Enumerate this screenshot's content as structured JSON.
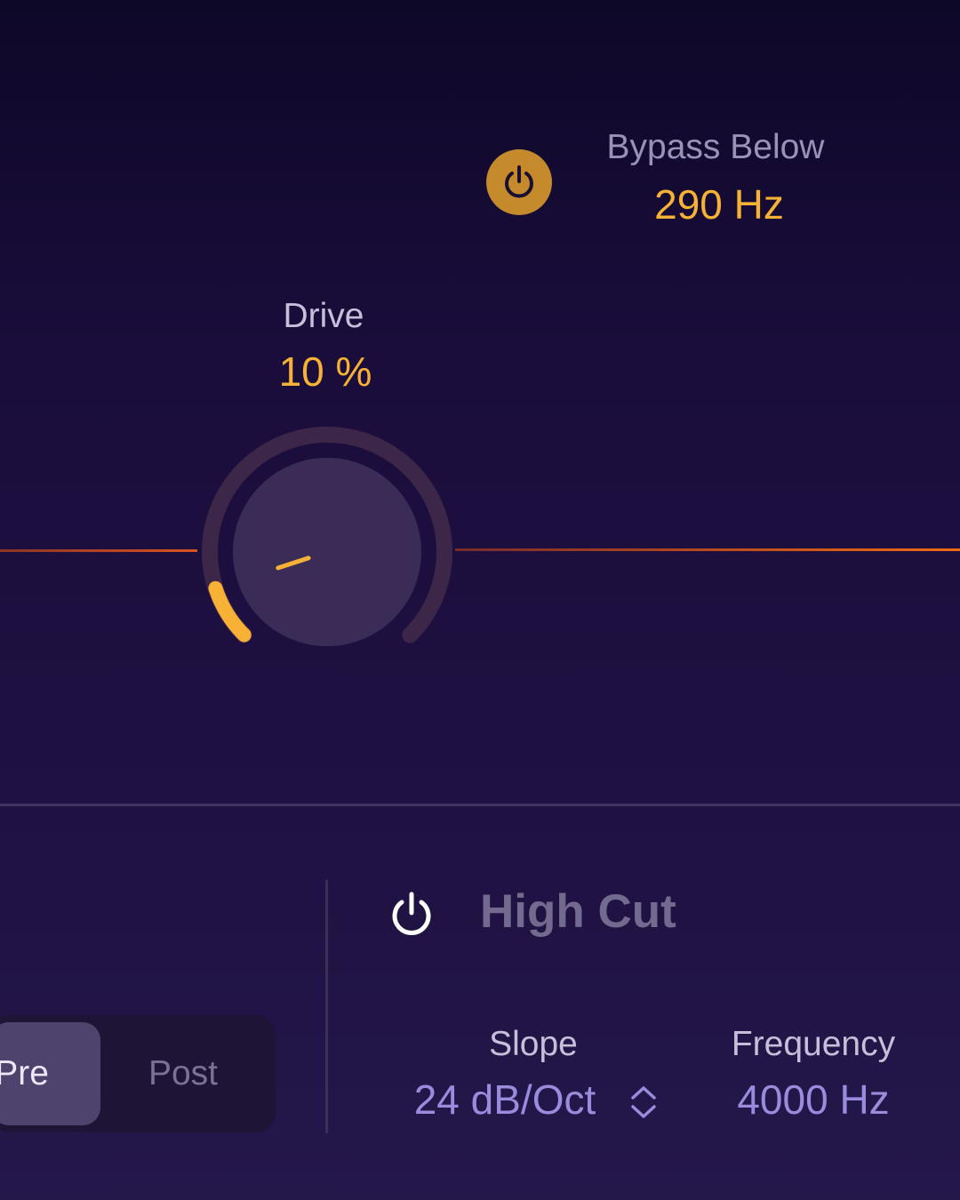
{
  "bypass": {
    "label": "Bypass Below",
    "value": "290 Hz",
    "enabled": true,
    "icon": "power-icon"
  },
  "drive": {
    "label": "Drive",
    "value_text": "10 %",
    "percent": 10
  },
  "routing": {
    "options": [
      "Pre",
      "Post"
    ],
    "selected": "Pre"
  },
  "high_cut": {
    "title": "High Cut",
    "enabled": false,
    "slope": {
      "label": "Slope",
      "value": "24 dB/Oct"
    },
    "frequency": {
      "label": "Frequency",
      "value": "4000 Hz"
    }
  },
  "colors": {
    "accent": "#f7b135",
    "power_active": "#c48a2c",
    "value_muted": "#9a8bdc",
    "background_top": "#0e0828",
    "background_bottom": "#24174a"
  }
}
